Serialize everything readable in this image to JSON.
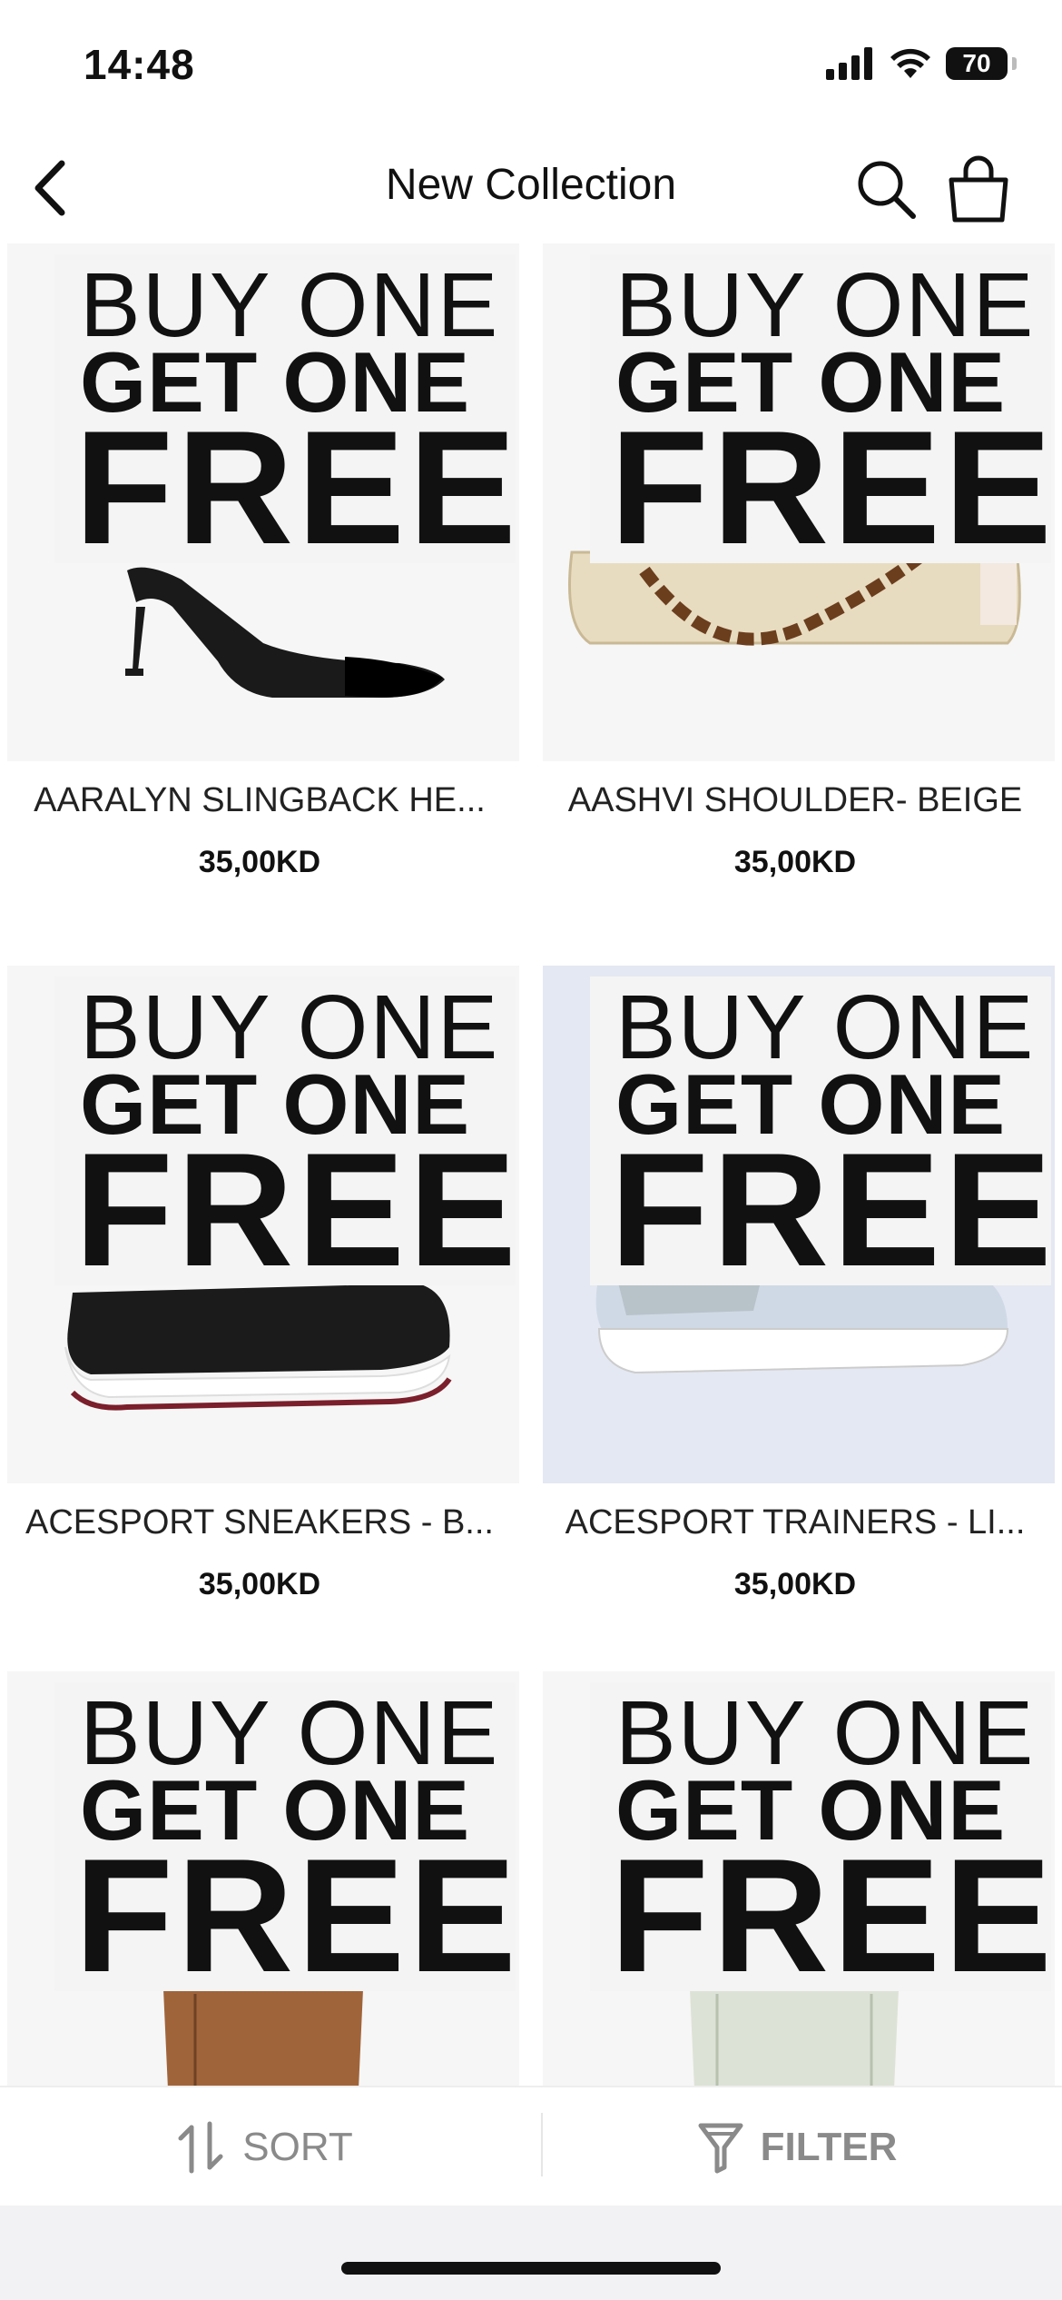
{
  "status_bar": {
    "time": "14:48",
    "battery": "70"
  },
  "nav": {
    "title": "New Collection"
  },
  "promo": {
    "line1": "BUY ONE",
    "line2": "GET ONE",
    "line3": "FREE"
  },
  "products": [
    {
      "name": "AARALYN SLINGBACK HE...",
      "price": "35,00KD",
      "image": "black-heel"
    },
    {
      "name": "AASHVI SHOULDER- BEIGE",
      "price": "35,00KD",
      "image": "beige-shoulder-bag"
    },
    {
      "name": "ACESPORT SNEAKERS - B...",
      "price": "35,00KD",
      "image": "black-sneaker"
    },
    {
      "name": "ACESPORT TRAINERS - LI...",
      "price": "35,00KD",
      "image": "light-blue-trainer"
    },
    {
      "name": "",
      "price": "",
      "image": "brown-boot"
    },
    {
      "name": "",
      "price": "",
      "image": "sage-bag"
    }
  ],
  "bottom_bar": {
    "sort_label": "SORT",
    "filter_label": "FILTER"
  }
}
